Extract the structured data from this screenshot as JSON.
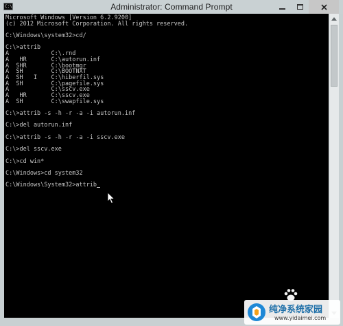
{
  "window": {
    "title": "Administrator: Command Prompt",
    "icon_text": "C:\\",
    "icons": {
      "app": "cmd-icon",
      "minimize": "minimize-icon",
      "maximize": "maximize-icon",
      "close": "close-icon"
    },
    "colors": {
      "frame": "#c8d0d2",
      "console_bg": "#000000",
      "console_fg": "#c6c6c6"
    }
  },
  "console": {
    "lines": [
      "Microsoft Windows [Version 6.2.9200]",
      "(c) 2012 Microsoft Corporation. All rights reserved.",
      "",
      "C:\\Windows\\system32>cd/",
      "",
      "C:\\>attrib",
      "A            C:\\.rnd",
      "A   HR       C:\\autorun.inf",
      "A  SHR       C:\\bootmgr",
      "A  SH        C:\\BOOTNXT",
      "A  SH   I    C:\\hiberfil.sys",
      "A  SH        C:\\pagefile.sys",
      "A            C:\\sscv.exe",
      "A   HR       C:\\sscv.exe",
      "A  SH        C:\\swapfile.sys",
      "",
      "C:\\>attrib -s -h -r -a -i autorun.inf",
      "",
      "C:\\>del autorun.inf",
      "",
      "C:\\>attrib -s -h -r -a -i sscv.exe",
      "",
      "C:\\>del sscv.exe",
      "",
      "C:\\>cd win*",
      "",
      "C:\\Windows>cd system32",
      "",
      "C:\\Windows\\System32>attrib"
    ]
  },
  "watermark": {
    "title": "纯净系统家园",
    "url": "www.yidaimei.com"
  }
}
